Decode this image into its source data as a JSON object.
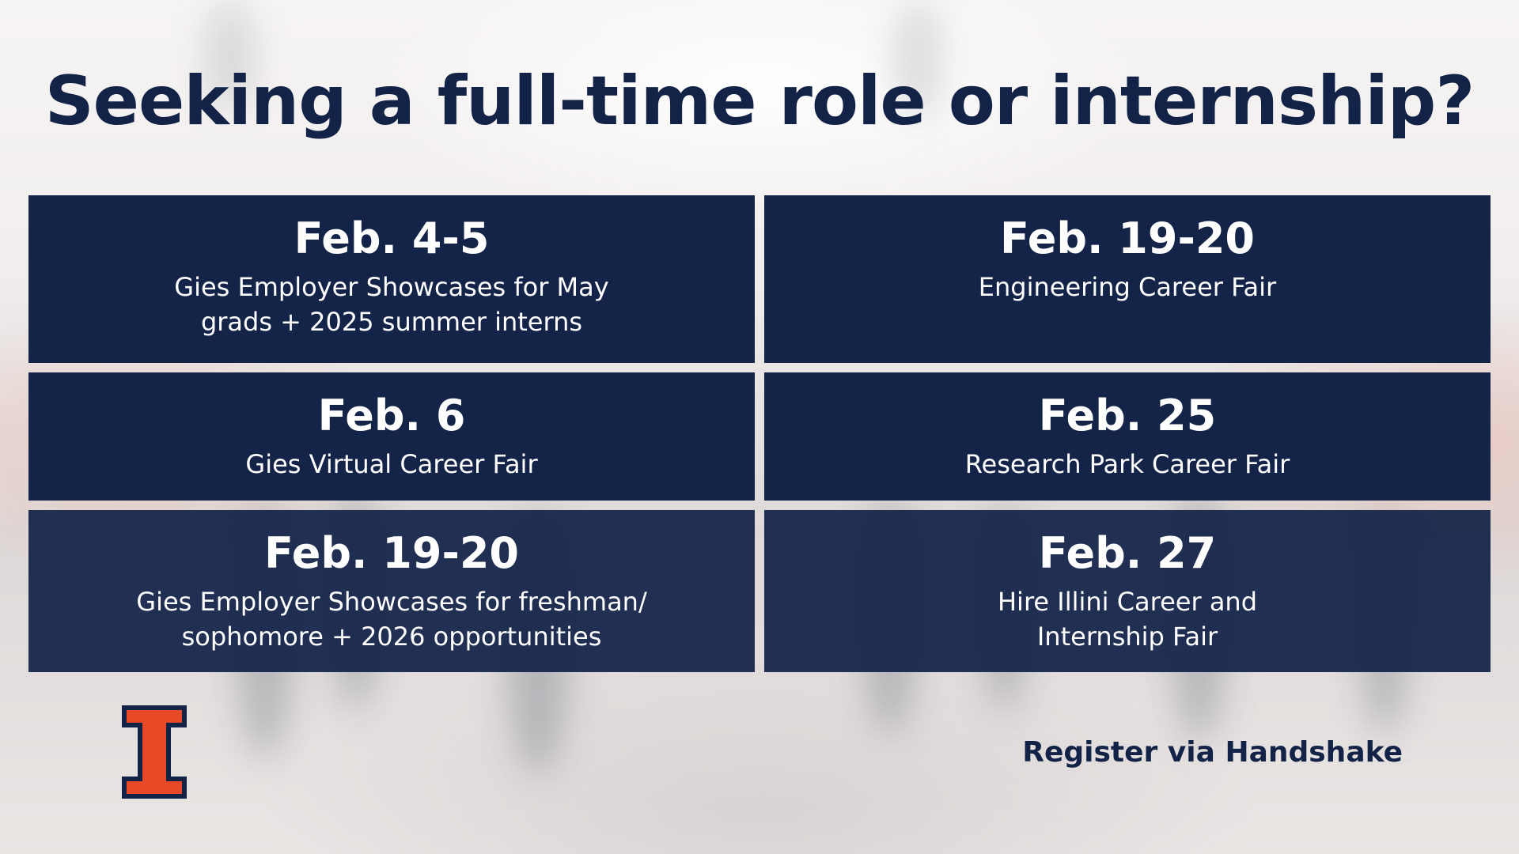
{
  "title": "Seeking a full-time role or internship?",
  "events": [
    {
      "date": "Feb. 4-5",
      "description": "Gies Employer Showcases for May\ngrads + 2025 summer interns"
    },
    {
      "date": "Feb. 19-20",
      "description": "Engineering Career Fair"
    },
    {
      "date": "Feb. 6",
      "description": "Gies Virtual Career Fair"
    },
    {
      "date": "Feb. 25",
      "description": "Research Park Career Fair"
    },
    {
      "date": "Feb. 19-20",
      "description": "Gies Employer Showcases for freshman/\nsophomore + 2026 opportunities"
    },
    {
      "date": "Feb. 27",
      "description": "Hire Illini Career and\nInternship Fair"
    }
  ],
  "footer": {
    "register_text": "Register via Handshake",
    "logo": "block-i-logo"
  },
  "colors": {
    "navy": "#132347",
    "orange": "#E84A27"
  }
}
